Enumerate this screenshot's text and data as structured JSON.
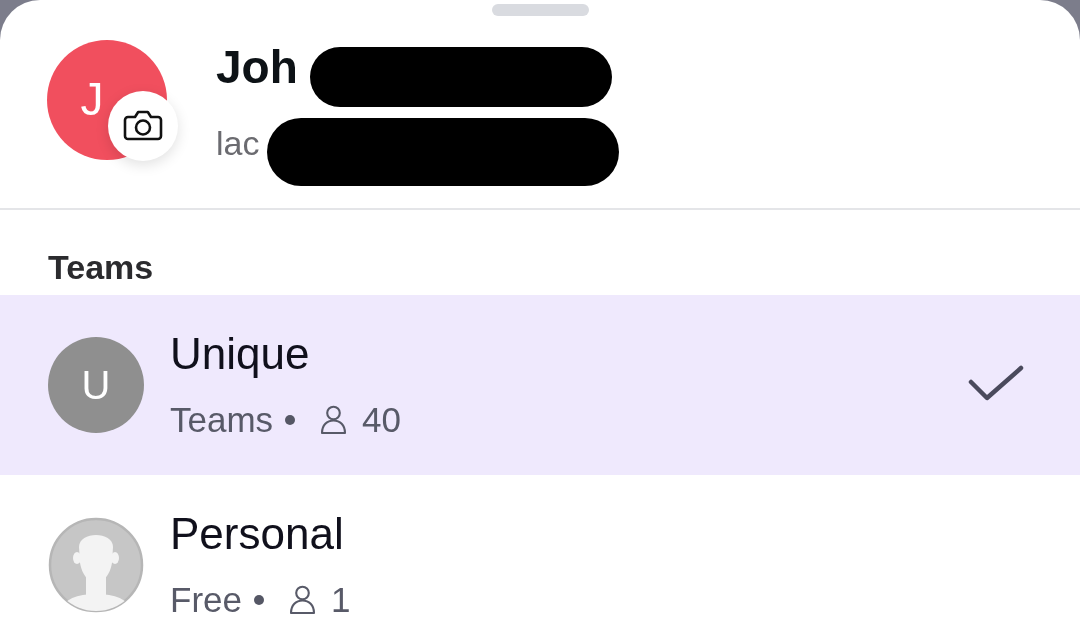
{
  "profile": {
    "avatar_initials": "J",
    "name": "Joh",
    "name_redacted": true,
    "email": "lac",
    "email_redacted": true
  },
  "teams_section": {
    "heading": "Teams",
    "items": [
      {
        "name": "Unique",
        "plan": "Teams",
        "members": "40",
        "avatar": {
          "kind": "initials",
          "text": "U"
        },
        "selected": true
      },
      {
        "name": "Personal",
        "plan": "Free",
        "members": "1",
        "avatar": {
          "kind": "default"
        },
        "selected": false
      }
    ]
  }
}
